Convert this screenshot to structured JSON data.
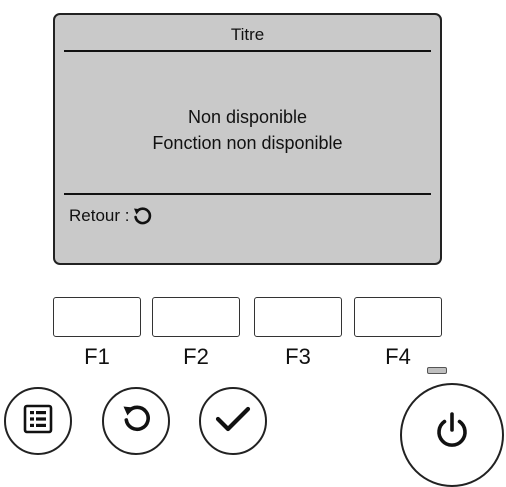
{
  "screen": {
    "title": "Titre",
    "message_line1": "Non disponible",
    "message_line2": "Fonction non disponible",
    "footer_label": "Retour :",
    "footer_icon": "return-icon"
  },
  "function_keys": [
    "F1",
    "F2",
    "F3",
    "F4"
  ],
  "buttons": {
    "menu": "menu-icon",
    "return": "return-icon",
    "select": "checkmark-icon",
    "power": "power-icon"
  },
  "colors": {
    "lcd_background": "#c9c9c9",
    "outline": "#222222"
  }
}
